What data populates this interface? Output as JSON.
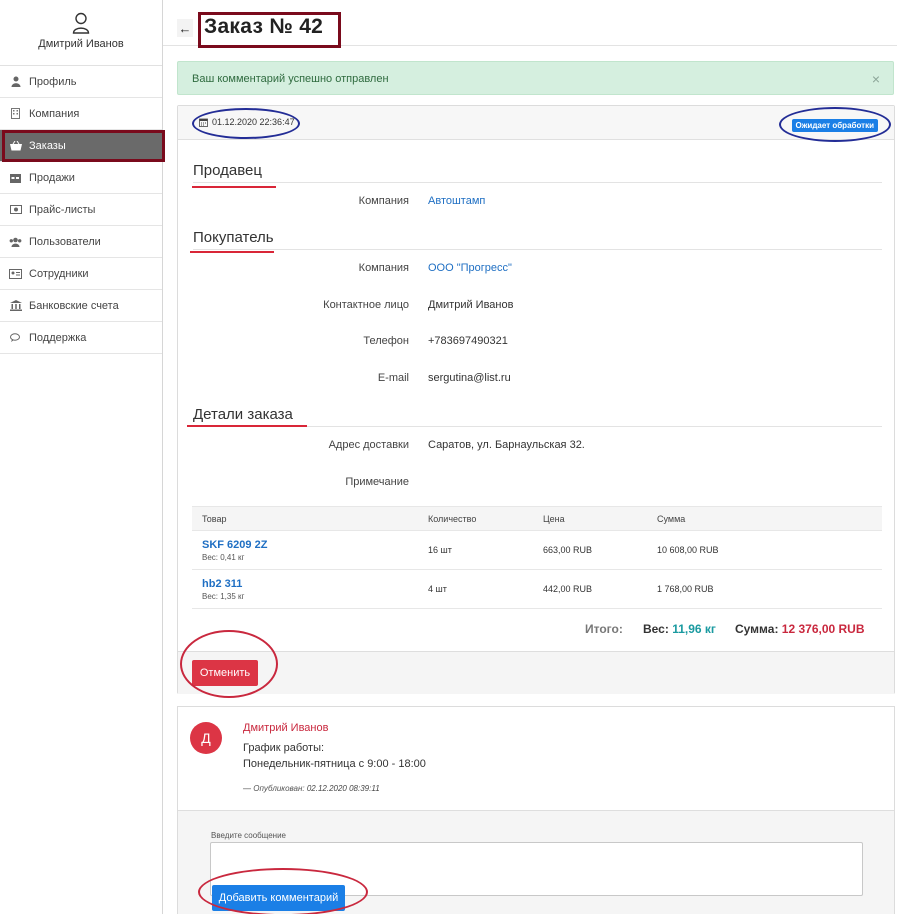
{
  "sidebar": {
    "user_name": "Дмитрий Иванов",
    "items": [
      {
        "label": "Профиль",
        "icon": "user-icon"
      },
      {
        "label": "Компания",
        "icon": "building-icon"
      },
      {
        "label": "Заказы",
        "icon": "basket-icon",
        "active": true
      },
      {
        "label": "Продажи",
        "icon": "calendar-icon"
      },
      {
        "label": "Прайс-листы",
        "icon": "money-icon"
      },
      {
        "label": "Пользователи",
        "icon": "users-icon"
      },
      {
        "label": "Сотрудники",
        "icon": "id-card-icon"
      },
      {
        "label": "Банковские счета",
        "icon": "bank-icon"
      },
      {
        "label": "Поддержка",
        "icon": "comments-icon"
      }
    ]
  },
  "header": {
    "back_symbol": "←",
    "title": "Заказ № 42"
  },
  "alert": {
    "message": "Ваш комментарий успешно отправлен",
    "close_symbol": "×"
  },
  "order": {
    "datetime": "01.12.2020 22:36:47",
    "status": "Ожидает обработки",
    "seller": {
      "title": "Продавец",
      "company_label": "Компания",
      "company": "Автоштамп"
    },
    "buyer": {
      "title": "Покупатель",
      "company_label": "Компания",
      "company": "ООО \"Прогресс\"",
      "contact_label": "Контактное лицо",
      "contact": "Дмитрий Иванов",
      "phone_label": "Телефон",
      "phone": "+783697490321",
      "email_label": "E-mail",
      "email": "sergutina@list.ru"
    },
    "details": {
      "title": "Детали заказа",
      "address_label": "Адрес доставки",
      "address": "Саратов, ул. Барнаульская 32.",
      "note_label": "Примечание",
      "note": ""
    },
    "table": {
      "headers": [
        "Товар",
        "Количество",
        "Цена",
        "Сумма"
      ],
      "rows": [
        {
          "name": "SKF 6209 2Z",
          "weight": "Вес: 0,41 кг",
          "qty": "16 шт",
          "price": "663,00 RUB",
          "sum": "10 608,00 RUB"
        },
        {
          "name": "hb2 311",
          "weight": "Вес: 1,35 кг",
          "qty": "4 шт",
          "price": "442,00 RUB",
          "sum": "1 768,00 RUB"
        }
      ]
    },
    "totals": {
      "label": "Итого:",
      "weight_label": "Вес:",
      "weight": "11,96 кг",
      "sum_label": "Сумма:",
      "sum": "12 376,00 RUB"
    },
    "cancel_label": "Отменить"
  },
  "comments": {
    "avatar_letter": "Д",
    "author": "Дмитрий Иванов",
    "text_line1": "График работы:",
    "text_line2": "Понедельник-пятница с 9:00 - 18:00",
    "meta_prefix": "— Опубликован:",
    "meta_date": "02.12.2020 08:39:11",
    "input_label": "Введите сообщение",
    "input_value": "",
    "add_label": "Добавить комментарий"
  },
  "colors": {
    "accent_blue": "#1b7fe6",
    "danger_red": "#dc3545",
    "success_bg": "#d5efdf",
    "annotation_dark_red": "#7a0a1c",
    "annotation_blue": "#232d96"
  }
}
